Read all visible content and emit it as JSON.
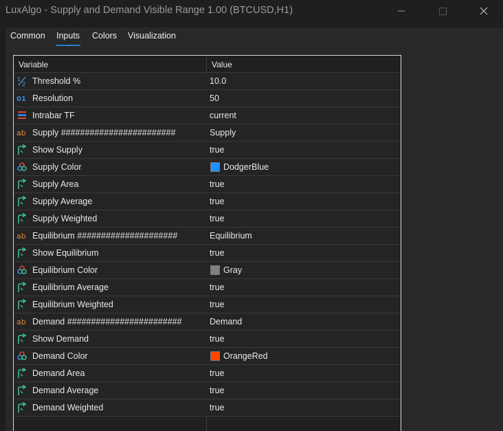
{
  "window": {
    "title": "LuxAlgo - Supply and Demand Visible Range 1.00 (BTCUSD,H1)"
  },
  "tabs": [
    {
      "label": "Common",
      "active": false
    },
    {
      "label": "Inputs",
      "active": true
    },
    {
      "label": "Colors",
      "active": false
    },
    {
      "label": "Visualization",
      "active": false
    }
  ],
  "grid": {
    "headers": {
      "variable": "Variable",
      "value": "Value"
    },
    "rows": [
      {
        "icon": "fraction-icon",
        "name": "Threshold %",
        "value": "10.0"
      },
      {
        "icon": "integer-icon",
        "name": "Resolution",
        "value": "50"
      },
      {
        "icon": "enum-icon",
        "name": "Intrabar TF",
        "value": "current"
      },
      {
        "icon": "string-icon",
        "name": "Supply ########################",
        "value": "Supply"
      },
      {
        "icon": "bool-icon",
        "name": "Show Supply",
        "value": "true"
      },
      {
        "icon": "color-icon",
        "name": "Supply Color",
        "value": "DodgerBlue",
        "swatch": "#1e90ff"
      },
      {
        "icon": "bool-icon",
        "name": "Supply Area",
        "value": "true"
      },
      {
        "icon": "bool-icon",
        "name": "Supply Average",
        "value": "true"
      },
      {
        "icon": "bool-icon",
        "name": "Supply Weighted",
        "value": "true"
      },
      {
        "icon": "string-icon",
        "name": "Equilibrium #####################",
        "value": "Equilibrium"
      },
      {
        "icon": "bool-icon",
        "name": "Show Equilibrium",
        "value": "true"
      },
      {
        "icon": "color-icon",
        "name": "Equilibrium Color",
        "value": "Gray",
        "swatch": "#808080"
      },
      {
        "icon": "bool-icon",
        "name": "Equilibrium Average",
        "value": "true"
      },
      {
        "icon": "bool-icon",
        "name": "Equilibrium Weighted",
        "value": "true"
      },
      {
        "icon": "string-icon",
        "name": "Demand ########################",
        "value": "Demand"
      },
      {
        "icon": "bool-icon",
        "name": "Show Demand",
        "value": "true"
      },
      {
        "icon": "color-icon",
        "name": "Demand Color",
        "value": "OrangeRed",
        "swatch": "#ff4500"
      },
      {
        "icon": "bool-icon",
        "name": "Demand Area",
        "value": "true"
      },
      {
        "icon": "bool-icon",
        "name": "Demand Average",
        "value": "true"
      },
      {
        "icon": "bool-icon",
        "name": "Demand Weighted",
        "value": "true"
      }
    ]
  },
  "colors": {
    "accent": "#2d7cd0"
  }
}
